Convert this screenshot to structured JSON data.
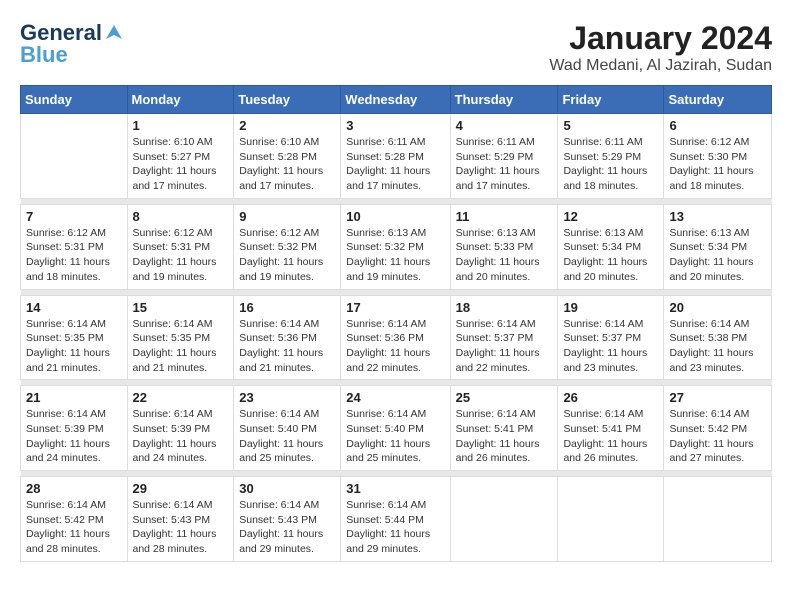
{
  "logo": {
    "general": "General",
    "blue": "Blue"
  },
  "title": {
    "month": "January 2024",
    "location": "Wad Medani, Al Jazirah, Sudan"
  },
  "headers": [
    "Sunday",
    "Monday",
    "Tuesday",
    "Wednesday",
    "Thursday",
    "Friday",
    "Saturday"
  ],
  "weeks": [
    [
      {
        "day": "",
        "info": ""
      },
      {
        "day": "1",
        "info": "Sunrise: 6:10 AM\nSunset: 5:27 PM\nDaylight: 11 hours\nand 17 minutes."
      },
      {
        "day": "2",
        "info": "Sunrise: 6:10 AM\nSunset: 5:28 PM\nDaylight: 11 hours\nand 17 minutes."
      },
      {
        "day": "3",
        "info": "Sunrise: 6:11 AM\nSunset: 5:28 PM\nDaylight: 11 hours\nand 17 minutes."
      },
      {
        "day": "4",
        "info": "Sunrise: 6:11 AM\nSunset: 5:29 PM\nDaylight: 11 hours\nand 17 minutes."
      },
      {
        "day": "5",
        "info": "Sunrise: 6:11 AM\nSunset: 5:29 PM\nDaylight: 11 hours\nand 18 minutes."
      },
      {
        "day": "6",
        "info": "Sunrise: 6:12 AM\nSunset: 5:30 PM\nDaylight: 11 hours\nand 18 minutes."
      }
    ],
    [
      {
        "day": "7",
        "info": "Sunrise: 6:12 AM\nSunset: 5:31 PM\nDaylight: 11 hours\nand 18 minutes."
      },
      {
        "day": "8",
        "info": "Sunrise: 6:12 AM\nSunset: 5:31 PM\nDaylight: 11 hours\nand 19 minutes."
      },
      {
        "day": "9",
        "info": "Sunrise: 6:12 AM\nSunset: 5:32 PM\nDaylight: 11 hours\nand 19 minutes."
      },
      {
        "day": "10",
        "info": "Sunrise: 6:13 AM\nSunset: 5:32 PM\nDaylight: 11 hours\nand 19 minutes."
      },
      {
        "day": "11",
        "info": "Sunrise: 6:13 AM\nSunset: 5:33 PM\nDaylight: 11 hours\nand 20 minutes."
      },
      {
        "day": "12",
        "info": "Sunrise: 6:13 AM\nSunset: 5:34 PM\nDaylight: 11 hours\nand 20 minutes."
      },
      {
        "day": "13",
        "info": "Sunrise: 6:13 AM\nSunset: 5:34 PM\nDaylight: 11 hours\nand 20 minutes."
      }
    ],
    [
      {
        "day": "14",
        "info": "Sunrise: 6:14 AM\nSunset: 5:35 PM\nDaylight: 11 hours\nand 21 minutes."
      },
      {
        "day": "15",
        "info": "Sunrise: 6:14 AM\nSunset: 5:35 PM\nDaylight: 11 hours\nand 21 minutes."
      },
      {
        "day": "16",
        "info": "Sunrise: 6:14 AM\nSunset: 5:36 PM\nDaylight: 11 hours\nand 21 minutes."
      },
      {
        "day": "17",
        "info": "Sunrise: 6:14 AM\nSunset: 5:36 PM\nDaylight: 11 hours\nand 22 minutes."
      },
      {
        "day": "18",
        "info": "Sunrise: 6:14 AM\nSunset: 5:37 PM\nDaylight: 11 hours\nand 22 minutes."
      },
      {
        "day": "19",
        "info": "Sunrise: 6:14 AM\nSunset: 5:37 PM\nDaylight: 11 hours\nand 23 minutes."
      },
      {
        "day": "20",
        "info": "Sunrise: 6:14 AM\nSunset: 5:38 PM\nDaylight: 11 hours\nand 23 minutes."
      }
    ],
    [
      {
        "day": "21",
        "info": "Sunrise: 6:14 AM\nSunset: 5:39 PM\nDaylight: 11 hours\nand 24 minutes."
      },
      {
        "day": "22",
        "info": "Sunrise: 6:14 AM\nSunset: 5:39 PM\nDaylight: 11 hours\nand 24 minutes."
      },
      {
        "day": "23",
        "info": "Sunrise: 6:14 AM\nSunset: 5:40 PM\nDaylight: 11 hours\nand 25 minutes."
      },
      {
        "day": "24",
        "info": "Sunrise: 6:14 AM\nSunset: 5:40 PM\nDaylight: 11 hours\nand 25 minutes."
      },
      {
        "day": "25",
        "info": "Sunrise: 6:14 AM\nSunset: 5:41 PM\nDaylight: 11 hours\nand 26 minutes."
      },
      {
        "day": "26",
        "info": "Sunrise: 6:14 AM\nSunset: 5:41 PM\nDaylight: 11 hours\nand 26 minutes."
      },
      {
        "day": "27",
        "info": "Sunrise: 6:14 AM\nSunset: 5:42 PM\nDaylight: 11 hours\nand 27 minutes."
      }
    ],
    [
      {
        "day": "28",
        "info": "Sunrise: 6:14 AM\nSunset: 5:42 PM\nDaylight: 11 hours\nand 28 minutes."
      },
      {
        "day": "29",
        "info": "Sunrise: 6:14 AM\nSunset: 5:43 PM\nDaylight: 11 hours\nand 28 minutes."
      },
      {
        "day": "30",
        "info": "Sunrise: 6:14 AM\nSunset: 5:43 PM\nDaylight: 11 hours\nand 29 minutes."
      },
      {
        "day": "31",
        "info": "Sunrise: 6:14 AM\nSunset: 5:44 PM\nDaylight: 11 hours\nand 29 minutes."
      },
      {
        "day": "",
        "info": ""
      },
      {
        "day": "",
        "info": ""
      },
      {
        "day": "",
        "info": ""
      }
    ]
  ]
}
